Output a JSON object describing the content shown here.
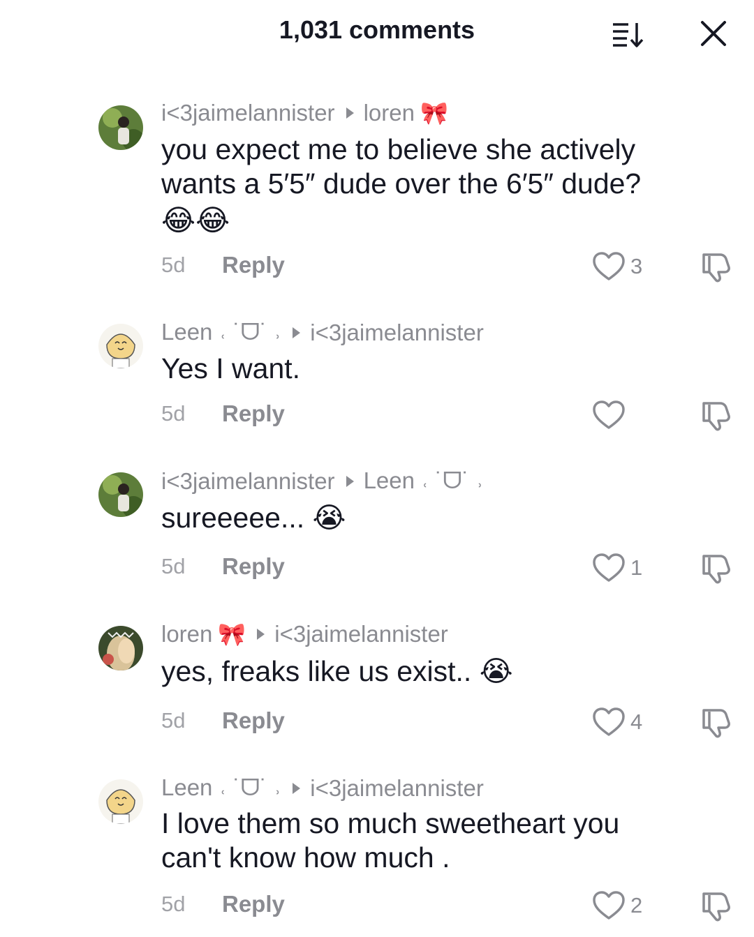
{
  "header": {
    "title": "1,031 comments",
    "sort_icon": "sort-list-icon",
    "close_icon": "close-icon"
  },
  "comments": [
    {
      "user": "i<3jaimelannister",
      "reply_to": "loren",
      "reply_to_decoration": "🎀",
      "text_lines": [
        "you expect me to believe she actively",
        "wants a 5′5″ dude over the 6′5″ dude?"
      ],
      "emojis": "😂😂",
      "time": "5d",
      "reply_label": "Reply",
      "likes": "3"
    },
    {
      "user": "Leen ˓ ˙ᗜ˙ ˒",
      "reply_to": "i<3jaimelannister",
      "text_lines": [
        "Yes I want."
      ],
      "time": "5d",
      "reply_label": "Reply",
      "likes": ""
    },
    {
      "user": "i<3jaimelannister",
      "reply_to": "Leen ˓ ˙ᗜ˙ ˒",
      "text_lines": [
        "sureeeee... 😭"
      ],
      "time": "5d",
      "reply_label": "Reply",
      "likes": "1"
    },
    {
      "user": "loren",
      "user_decoration": "🎀",
      "reply_to": "i<3jaimelannister",
      "text_lines": [
        "yes, freaks like us exist.. 😭"
      ],
      "time": "5d",
      "reply_label": "Reply",
      "likes": "4"
    },
    {
      "user": "Leen ˓ ˙ᗜ˙ ˒",
      "reply_to": "i<3jaimelannister",
      "text_lines": [
        "I love them so much sweetheart you",
        "can't know how much ."
      ],
      "time": "5d",
      "reply_label": "Reply",
      "likes": "2"
    }
  ]
}
